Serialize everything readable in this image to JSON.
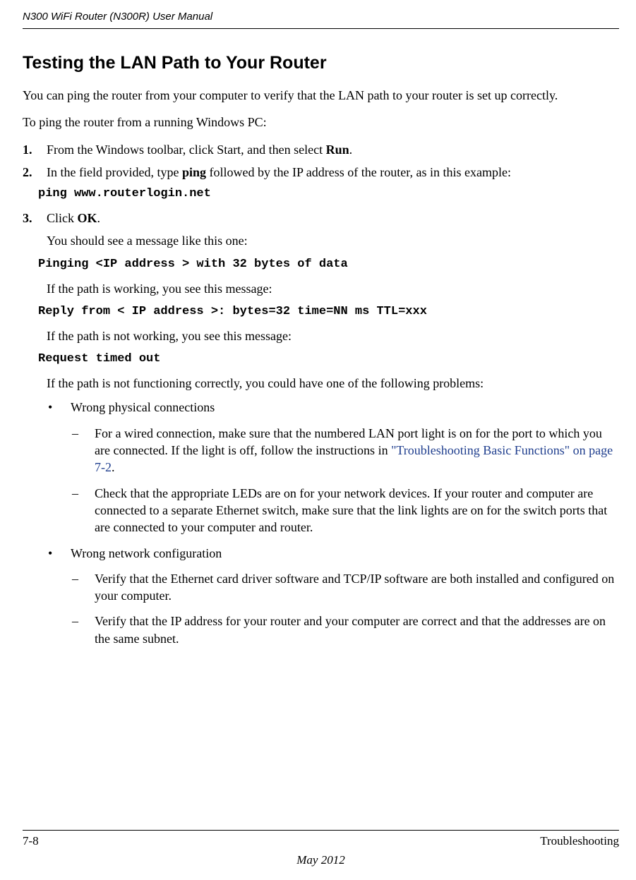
{
  "header": {
    "doc_title": "N300 WiFi Router (N300R) User Manual"
  },
  "section": {
    "title": "Testing the LAN Path to Your Router",
    "intro": "You can ping the router from your computer to verify that the LAN path to your router is set up correctly.",
    "lead": "To ping the router from a running Windows PC:"
  },
  "steps": {
    "s1_marker": "1.",
    "s1_pre": "From the Windows toolbar, click Start, and then select ",
    "s1_bold": "Run",
    "s1_post": ".",
    "s2_marker": "2.",
    "s2_pre": "In the field provided, type ",
    "s2_bold": "ping",
    "s2_post": " followed by the IP address of the router, as in this example:",
    "s2_code": "ping www.routerlogin.net",
    "s3_marker": "3.",
    "s3_pre": "Click ",
    "s3_bold": "OK",
    "s3_post": "."
  },
  "result": {
    "line1": "You should see a message like this one:",
    "code1": "Pinging <IP address > with 32 bytes of data",
    "line2": "If the path is working, you see this message:",
    "code2": "Reply from < IP address >: bytes=32 time=NN ms TTL=xxx",
    "line3": "If the path is not working, you see this message:",
    "code3": "Request timed out",
    "line4": "If the path is not functioning correctly, you could have one of the following problems:"
  },
  "bullets": {
    "b1": "Wrong physical connections",
    "b1_d1_pre": "For a wired connection, make sure that the numbered LAN port light is on for the port to which you are connected. If the light is off, follow the instructions in ",
    "b1_d1_link": "\"Troubleshooting Basic Functions\" on page 7-2",
    "b1_d1_post": ".",
    "b1_d2": "Check that the appropriate LEDs are on for your network devices. If your router and computer are connected to a separate Ethernet switch, make sure that the link lights are on for the switch ports that are connected to your computer and router.",
    "b2": "Wrong network configuration",
    "b2_d1": "Verify that the Ethernet card driver software and TCP/IP software are both installed and configured on your computer.",
    "b2_d2": "Verify that the IP address for your router and your computer are correct and that the addresses are on the same subnet."
  },
  "footer": {
    "page_label": "7-8",
    "section_label": "Troubleshooting",
    "date": "May 2012"
  },
  "glyphs": {
    "bullet": "•",
    "dash": "–"
  }
}
